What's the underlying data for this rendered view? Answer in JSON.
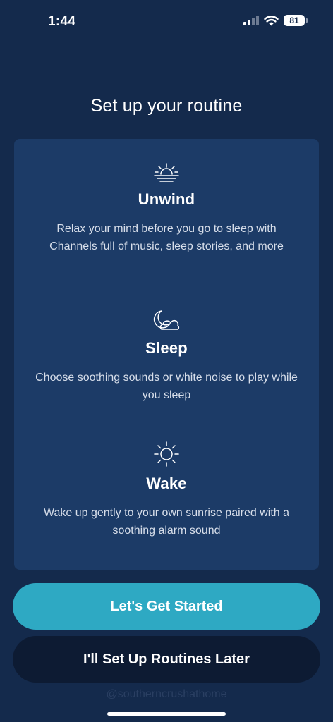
{
  "status_bar": {
    "time": "1:44",
    "battery_level": "81",
    "signal_bars_active": 2,
    "signal_bars_total": 4
  },
  "page_title": "Set up your routine",
  "sections": [
    {
      "icon": "sunset-icon",
      "title": "Unwind",
      "description": "Relax your mind before you go to sleep with Channels full of music, sleep stories, and more"
    },
    {
      "icon": "moon-cloud-icon",
      "title": "Sleep",
      "description": "Choose soothing sounds or white noise to play while you sleep"
    },
    {
      "icon": "sun-icon",
      "title": "Wake",
      "description": "Wake up gently to your own sunrise paired with a soothing alarm sound"
    }
  ],
  "buttons": {
    "primary_label": "Let's Get Started",
    "secondary_label": "I'll Set Up Routines Later"
  },
  "watermark": "@southerncrushathome",
  "colors": {
    "background": "#142a4c",
    "card": "#1c3b67",
    "primary_button": "#2ea9c3",
    "secondary_button": "#0d1b33"
  }
}
